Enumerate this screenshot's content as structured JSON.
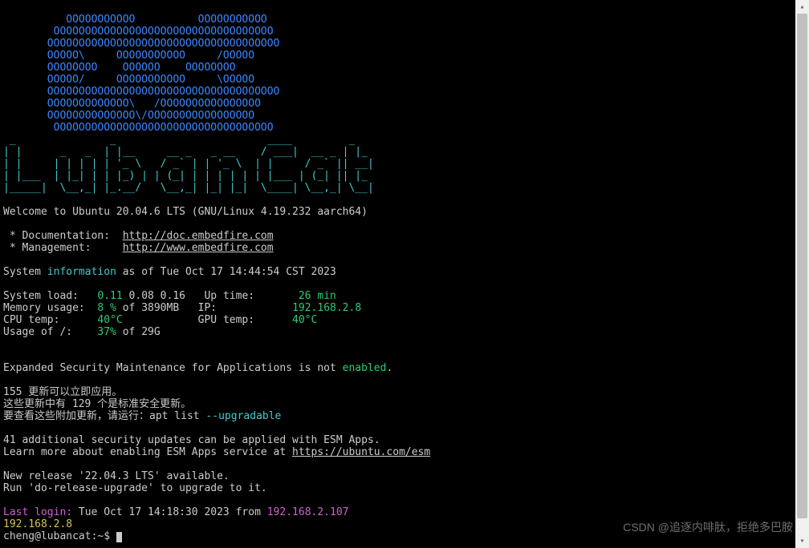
{
  "ascii_top": [
    "          OOOOOOOOOOO          OOOOOOOOOOO",
    "        OOOOOOOOOOOOOOOOOOOOOOOOOOOOOOOOOOO",
    "       OOOOOOOOOOOOOOOOOOOOOOOOOOOOOOOOOOOOO",
    "       OOOOO\\     OOOOOOOOOOO     /OOOOO",
    "       OOOOOOOO    OOOOOO    OOOOOOOO",
    "       OOOOO/     OOOOOOOOOOO     \\OOOOO",
    "       OOOOOOOOOOOOOOOOOOOOOOOOOOOOOOOOOOOOO",
    "       OOOOOOOOOOOOO\\   /OOOOOOOOOOOOOOOO",
    "       OOOOOOOOOOOOOO\\/OOOOOOOOOOOOOOOOO",
    "        OOOOOOOOOOOOOOOOOOOOOOOOOOOOOOOOOOO"
  ],
  "ascii_logo": [
    " _               _                        ____         _",
    "| |      _   _  | |__     __ _   _ __    / ___|  __ _ | |_",
    "| |     | | | | | '_ \\   / _` | | '_ \\  | |     / _` || __|",
    "| |___  | |_| | | |_) | | (_| | | | | | | |___ | (_| || |_",
    "|_____|  \\__,_| |_.__/   \\__,_| |_| |_|  \\____| \\__,_| \\__|"
  ],
  "welcome": "Welcome to Ubuntu 20.04.6 LTS (GNU/Linux 4.19.232 aarch64)",
  "doc_label": " * Documentation:  ",
  "doc_url": "http://doc.embedfire.com",
  "mgmt_label": " * Management:     ",
  "mgmt_url": "http://www.embedfire.com",
  "sysinfo_pre": "System ",
  "sysinfo_word": "information",
  "sysinfo_post": " as of Tue Oct 17 14:44:54 CST 2023",
  "stats": {
    "load_label": "System load:   ",
    "load_val": "0.11",
    "load_rest": " 0.08 0.16",
    "uptime_label": "   Up time:       ",
    "uptime_val": "26 min",
    "mem_label": "Memory usage:  ",
    "mem_val": "8 %",
    "mem_rest": " of 3890MB",
    "ip_label": "   IP:            ",
    "ip_val": "192.168.2.8",
    "cpu_label": "CPU temp:      ",
    "cpu_val": "40°C",
    "gpu_label": "            GPU temp:      ",
    "gpu_val": "40°C",
    "root_label": "Usage of /:    ",
    "root_val": "37%",
    "root_rest": " of 29G"
  },
  "esm_pre": "Expanded Security Maintenance for Applications is not ",
  "esm_word": "enabled",
  "esm_post": ".",
  "updates1": "155 更新可以立即应用。",
  "updates2": "这些更新中有 129 个是标准安全更新。",
  "updates3_pre": "要查看这些附加更新，请运行：apt list ",
  "updates3_opt": "--upgradable",
  "esm2a": "41 additional security updates can be applied with ESM Apps.",
  "esm2b_pre": "Learn more about enabling ESM Apps service at ",
  "esm2b_url": "https://ubuntu.com/esm",
  "rel1": "New release '22.04.3 LTS' available.",
  "rel2": "Run 'do-release-upgrade' to upgrade to it.",
  "last_login_label": "Last login:",
  "last_login_rest": " Tue Oct 17 14:18:30 2023 from ",
  "last_login_ip": "192.168.2.107",
  "motd_ip": "192.168.2.8",
  "prompt_user": "cheng@lubancat",
  "prompt_path": "~",
  "prompt_suffix": "$ ",
  "watermark": "CSDN @追逐内啡肽，拒绝多巴胺"
}
